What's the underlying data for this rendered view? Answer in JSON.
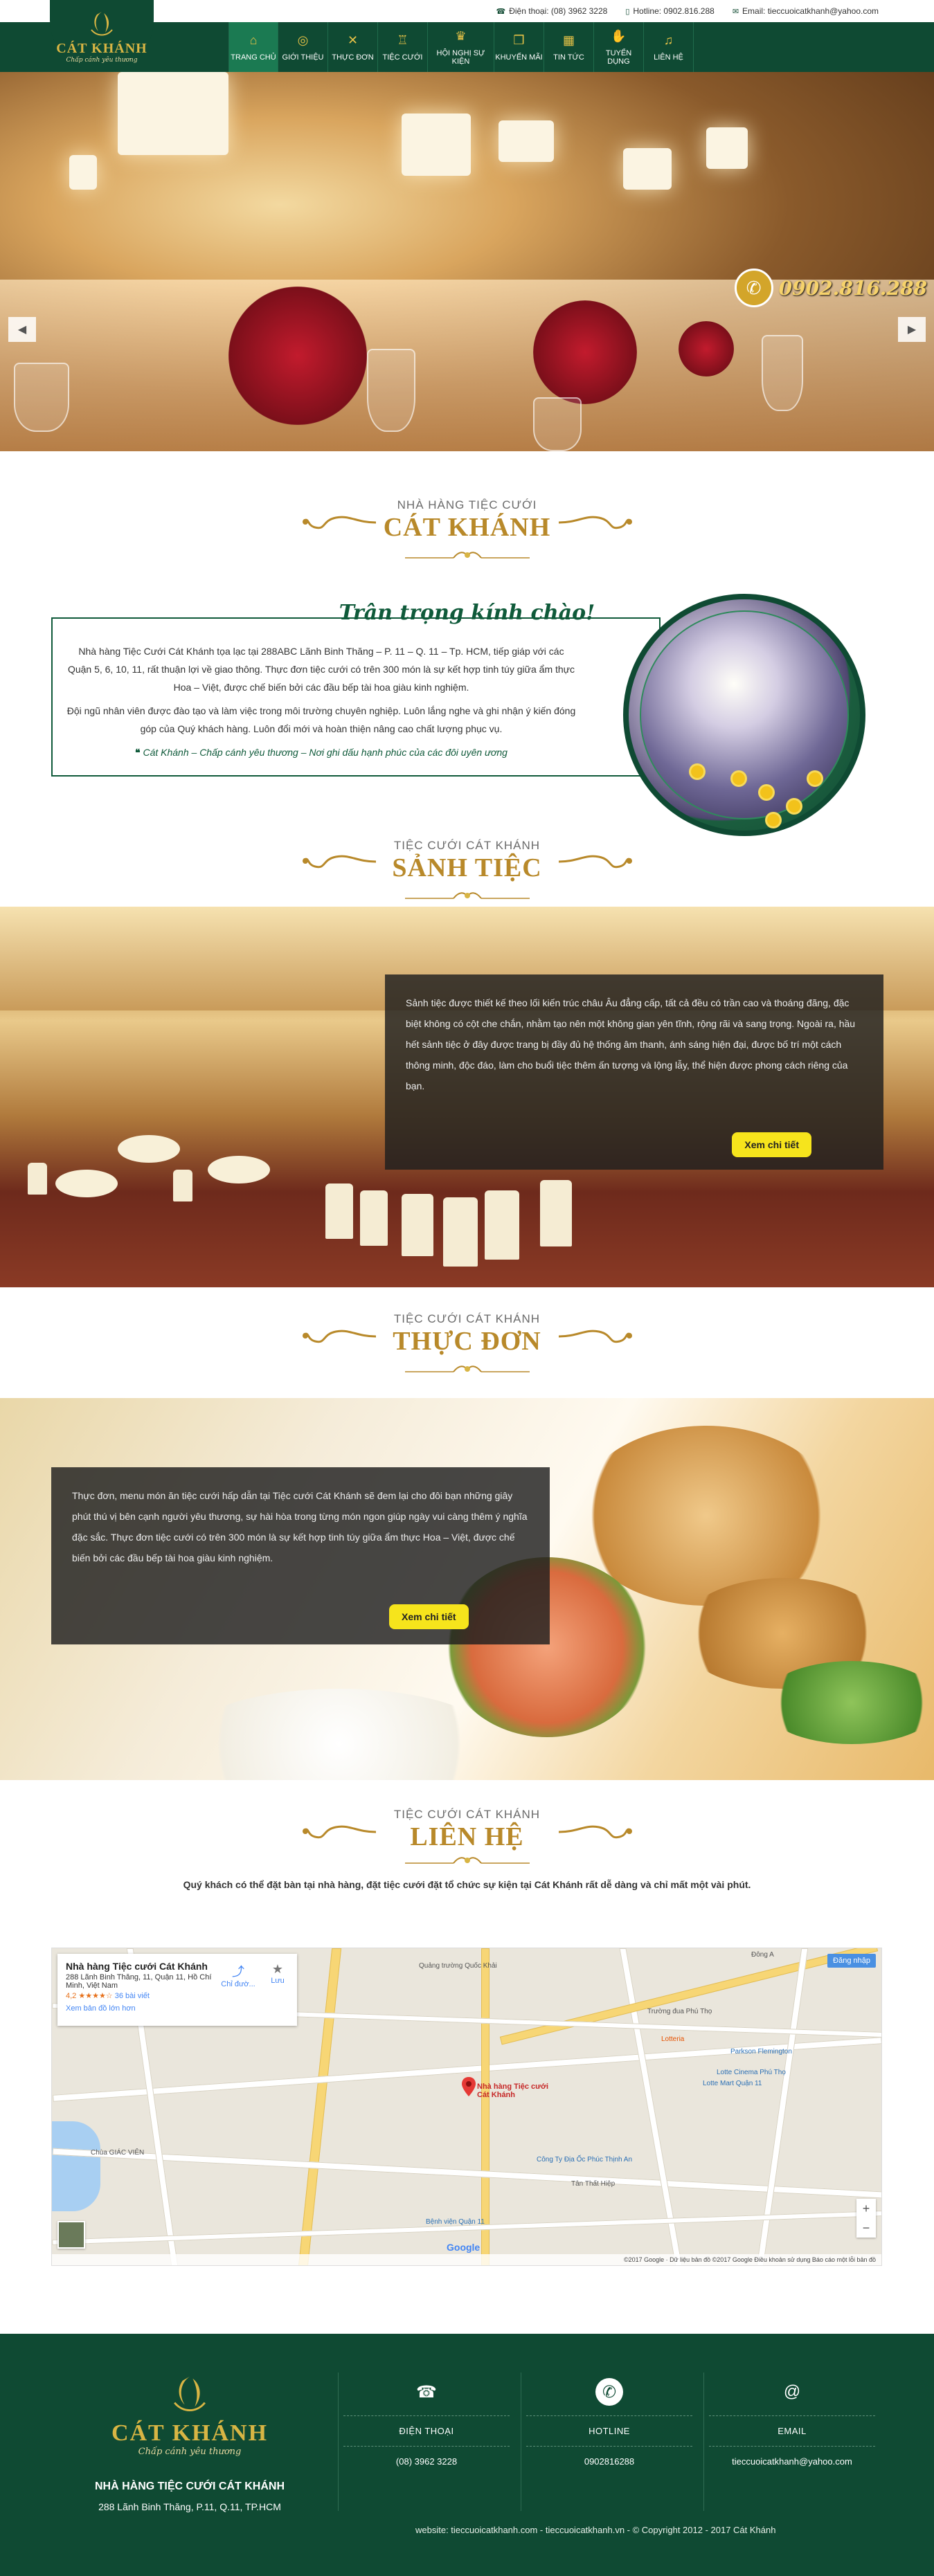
{
  "topbar": {
    "phone_label": "Điện thoại: (08) 3962 3228",
    "hotline_label": "Hotline: 0902.816.288",
    "email_label": "Email: tieccuoicatkhanh@yahoo.com"
  },
  "logo": {
    "title": "CÁT KHÁNH",
    "subtitle": "Chấp cánh yêu thương"
  },
  "nav": [
    {
      "label": "TRANG CHỦ",
      "icon": "home-icon"
    },
    {
      "label": "GIỚI THIỆU",
      "icon": "rings-icon"
    },
    {
      "label": "THỰC ĐƠN",
      "icon": "cutlery-icon"
    },
    {
      "label": "TIỆC CƯỚI",
      "icon": "cake-icon"
    },
    {
      "label": "HỘI NGHỊ SỰ KIỆN",
      "icon": "event-icon"
    },
    {
      "label": "KHUYẾN MÃI",
      "icon": "gift-icon"
    },
    {
      "label": "TIN TỨC",
      "icon": "calendar-icon"
    },
    {
      "label": "TUYỂN DỤNG",
      "icon": "handshake-icon"
    },
    {
      "label": "LIÊN HỆ",
      "icon": "bell-icon"
    }
  ],
  "hero": {
    "hotline": "0902.816.288"
  },
  "about": {
    "sup": "NHÀ HÀNG TIỆC CƯỚI",
    "title": "CÁT KHÁNH",
    "welcome": "Trân trọng kính chào!",
    "p1": "Nhà hàng Tiệc Cưới Cát Khánh tọa lạc tại 288ABC Lãnh Binh Thăng – P. 11 – Q. 11 – Tp. HCM, tiếp giáp với các Quận 5, 6, 10, 11, rất thuận lợi về giao thông. Thực đơn tiệc cưới có trên 300 món là sự kết hợp tinh túy giữa ẩm thực Hoa – Việt, được chế biến bởi các đầu bếp tài hoa giàu kinh nghiệm.",
    "p2": "Đội ngũ nhân viên được đào tạo và làm việc trong môi trường chuyên nghiệp. Luôn lắng nghe và ghi nhận ý kiến đóng góp của Quý khách hàng. Luôn đổi mới và hoàn thiện nâng cao chất lượng phục vụ.",
    "quote": "Cát Khánh – Chấp cánh yêu thương – Nơi ghi dấu hạnh phúc của các đôi uyên ương"
  },
  "hall": {
    "sup": "TIỆC CƯỚI CÁT KHÁNH",
    "title": "SẢNH TIỆC",
    "text": "Sảnh tiệc được thiết kế theo lối kiến trúc châu Âu đẳng cấp, tất cả đều có trần cao và thoáng đãng, đặc biệt không có cột che chắn, nhằm tạo nên một không gian yên tĩnh, rộng rãi và sang trọng. Ngoài ra, hầu hết sảnh tiệc ở đây được trang bị đầy đủ hệ thống âm thanh, ánh sáng hiện đại, được bố trí một cách thông minh, độc đáo, làm cho buổi tiệc thêm ấn tượng và lộng lẫy, thể hiện được phong cách riêng của bạn.",
    "button": "Xem chi tiết"
  },
  "menu": {
    "sup": "TIỆC CƯỚI CÁT KHÁNH",
    "title": "THỰC ĐƠN",
    "text": "Thực đơn, menu món ăn tiệc cưới hấp dẫn tại Tiệc cưới Cát Khánh sẽ đem lại cho đôi bạn những giây phút thú vị bên cạnh người yêu thương, sự hài hòa trong từng món ngon giúp ngày vui càng thêm ý nghĩa đặc sắc. Thực đơn tiệc cưới có trên 300 món là sự kết hợp tinh túy giữa ẩm thực Hoa – Việt, được chế biến bởi các đầu bếp tài hoa giàu kinh nghiệm.",
    "button": "Xem chi tiết"
  },
  "contact": {
    "sup": "TIỆC CƯỚI CÁT KHÁNH",
    "title": "LIÊN HỆ",
    "desc": "Quý khách có thể đặt bàn tại nhà hàng, đặt tiệc cưới đặt tổ chức sự kiện tại Cát Khánh rất dễ dàng và chỉ mất một vài phút.",
    "map": {
      "card_title": "Nhà hàng Tiệc cưới Cát Khánh",
      "card_addr": "288 Lãnh Binh Thăng, 11, Quận 11, Hồ Chí Minh, Việt Nam",
      "rating": "4,2",
      "reviews": "36 bài viết",
      "directions": "Chỉ đườ...",
      "save": "Lưu",
      "larger": "Xem bản đồ lớn hơn",
      "pin_label": "Nhà hàng Tiệc cưới Cát Khánh",
      "expand": "Đăng nhập",
      "footer": "©2017 Google · Dữ liệu bản đồ ©2017 Google   Điều khoản sử dụng   Báo cáo một lỗi bản đồ",
      "labels": [
        "Quảng trường Quốc Khải",
        "Đông A",
        "Trường đua Phú Thọ",
        "Parkson Flemington",
        "Lotteria",
        "Lotte Mart Quận 11",
        "Công Ty Địa Ốc Phúc Thịnh An",
        "Chùa GIÁC VIÊN",
        "Bệnh viện Quận 11",
        "Lotte Cinema Phú Thọ",
        "Tân Thất Hiệp"
      ]
    }
  },
  "footer": {
    "logo_title": "CÁT KHÁNH",
    "logo_sub": "Chấp cánh yêu thương",
    "name": "NHÀ HÀNG TIỆC CƯỚI CÁT KHÁNH",
    "address": "288 Lãnh Binh Thăng, P.11, Q.11, TP.HCM",
    "phone_label": "ĐIỆN THOẠI",
    "phone": "(08) 3962 3228",
    "hotline_label": "HOTLINE",
    "hotline": "0902816288",
    "email_label": "EMAIL",
    "email": "tieccuoicatkhanh@yahoo.com",
    "copyright": "website: tieccuoicatkhanh.com - tieccuoicatkhanh.vn - © Copyright 2012 - 2017 Cát Khánh"
  },
  "colors": {
    "brand_green": "#0f4a33",
    "gold": "#b8892a",
    "button_yellow": "#f6e41c"
  }
}
